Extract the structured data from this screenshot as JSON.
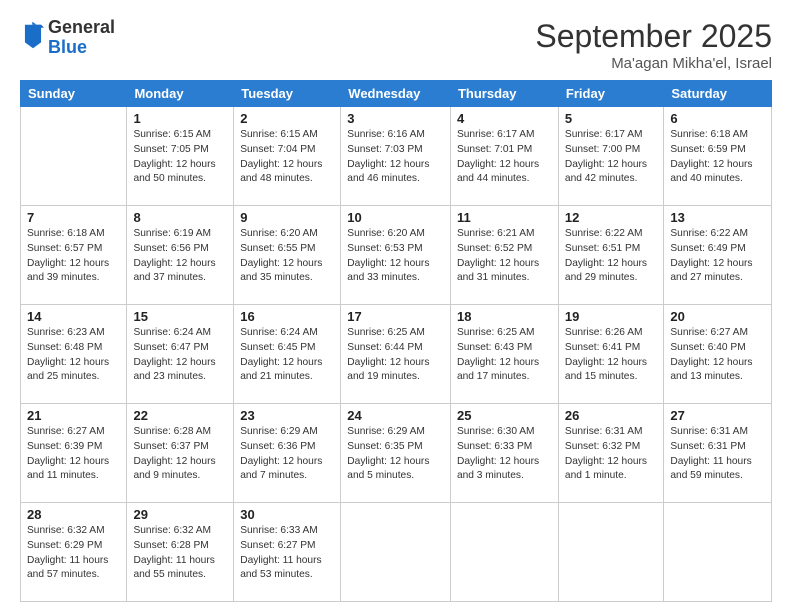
{
  "logo": {
    "general": "General",
    "blue": "Blue"
  },
  "header": {
    "month": "September 2025",
    "location": "Ma'agan Mikha'el, Israel"
  },
  "days_of_week": [
    "Sunday",
    "Monday",
    "Tuesday",
    "Wednesday",
    "Thursday",
    "Friday",
    "Saturday"
  ],
  "weeks": [
    [
      {
        "day": "",
        "info": ""
      },
      {
        "day": "1",
        "info": "Sunrise: 6:15 AM\nSunset: 7:05 PM\nDaylight: 12 hours\nand 50 minutes."
      },
      {
        "day": "2",
        "info": "Sunrise: 6:15 AM\nSunset: 7:04 PM\nDaylight: 12 hours\nand 48 minutes."
      },
      {
        "day": "3",
        "info": "Sunrise: 6:16 AM\nSunset: 7:03 PM\nDaylight: 12 hours\nand 46 minutes."
      },
      {
        "day": "4",
        "info": "Sunrise: 6:17 AM\nSunset: 7:01 PM\nDaylight: 12 hours\nand 44 minutes."
      },
      {
        "day": "5",
        "info": "Sunrise: 6:17 AM\nSunset: 7:00 PM\nDaylight: 12 hours\nand 42 minutes."
      },
      {
        "day": "6",
        "info": "Sunrise: 6:18 AM\nSunset: 6:59 PM\nDaylight: 12 hours\nand 40 minutes."
      }
    ],
    [
      {
        "day": "7",
        "info": "Sunrise: 6:18 AM\nSunset: 6:57 PM\nDaylight: 12 hours\nand 39 minutes."
      },
      {
        "day": "8",
        "info": "Sunrise: 6:19 AM\nSunset: 6:56 PM\nDaylight: 12 hours\nand 37 minutes."
      },
      {
        "day": "9",
        "info": "Sunrise: 6:20 AM\nSunset: 6:55 PM\nDaylight: 12 hours\nand 35 minutes."
      },
      {
        "day": "10",
        "info": "Sunrise: 6:20 AM\nSunset: 6:53 PM\nDaylight: 12 hours\nand 33 minutes."
      },
      {
        "day": "11",
        "info": "Sunrise: 6:21 AM\nSunset: 6:52 PM\nDaylight: 12 hours\nand 31 minutes."
      },
      {
        "day": "12",
        "info": "Sunrise: 6:22 AM\nSunset: 6:51 PM\nDaylight: 12 hours\nand 29 minutes."
      },
      {
        "day": "13",
        "info": "Sunrise: 6:22 AM\nSunset: 6:49 PM\nDaylight: 12 hours\nand 27 minutes."
      }
    ],
    [
      {
        "day": "14",
        "info": "Sunrise: 6:23 AM\nSunset: 6:48 PM\nDaylight: 12 hours\nand 25 minutes."
      },
      {
        "day": "15",
        "info": "Sunrise: 6:24 AM\nSunset: 6:47 PM\nDaylight: 12 hours\nand 23 minutes."
      },
      {
        "day": "16",
        "info": "Sunrise: 6:24 AM\nSunset: 6:45 PM\nDaylight: 12 hours\nand 21 minutes."
      },
      {
        "day": "17",
        "info": "Sunrise: 6:25 AM\nSunset: 6:44 PM\nDaylight: 12 hours\nand 19 minutes."
      },
      {
        "day": "18",
        "info": "Sunrise: 6:25 AM\nSunset: 6:43 PM\nDaylight: 12 hours\nand 17 minutes."
      },
      {
        "day": "19",
        "info": "Sunrise: 6:26 AM\nSunset: 6:41 PM\nDaylight: 12 hours\nand 15 minutes."
      },
      {
        "day": "20",
        "info": "Sunrise: 6:27 AM\nSunset: 6:40 PM\nDaylight: 12 hours\nand 13 minutes."
      }
    ],
    [
      {
        "day": "21",
        "info": "Sunrise: 6:27 AM\nSunset: 6:39 PM\nDaylight: 12 hours\nand 11 minutes."
      },
      {
        "day": "22",
        "info": "Sunrise: 6:28 AM\nSunset: 6:37 PM\nDaylight: 12 hours\nand 9 minutes."
      },
      {
        "day": "23",
        "info": "Sunrise: 6:29 AM\nSunset: 6:36 PM\nDaylight: 12 hours\nand 7 minutes."
      },
      {
        "day": "24",
        "info": "Sunrise: 6:29 AM\nSunset: 6:35 PM\nDaylight: 12 hours\nand 5 minutes."
      },
      {
        "day": "25",
        "info": "Sunrise: 6:30 AM\nSunset: 6:33 PM\nDaylight: 12 hours\nand 3 minutes."
      },
      {
        "day": "26",
        "info": "Sunrise: 6:31 AM\nSunset: 6:32 PM\nDaylight: 12 hours\nand 1 minute."
      },
      {
        "day": "27",
        "info": "Sunrise: 6:31 AM\nSunset: 6:31 PM\nDaylight: 11 hours\nand 59 minutes."
      }
    ],
    [
      {
        "day": "28",
        "info": "Sunrise: 6:32 AM\nSunset: 6:29 PM\nDaylight: 11 hours\nand 57 minutes."
      },
      {
        "day": "29",
        "info": "Sunrise: 6:32 AM\nSunset: 6:28 PM\nDaylight: 11 hours\nand 55 minutes."
      },
      {
        "day": "30",
        "info": "Sunrise: 6:33 AM\nSunset: 6:27 PM\nDaylight: 11 hours\nand 53 minutes."
      },
      {
        "day": "",
        "info": ""
      },
      {
        "day": "",
        "info": ""
      },
      {
        "day": "",
        "info": ""
      },
      {
        "day": "",
        "info": ""
      }
    ]
  ]
}
